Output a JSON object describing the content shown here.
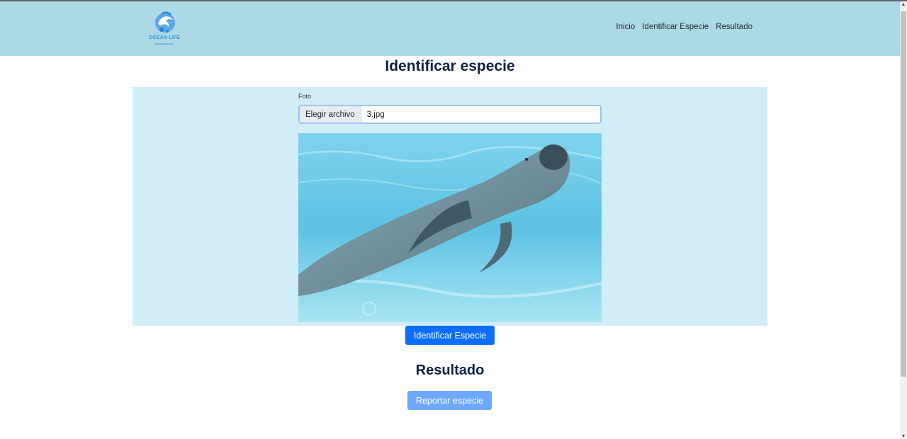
{
  "navbar": {
    "logo_text": "OCEAN LIFE",
    "links": [
      "Inicio",
      "Identificar Especie",
      "Resultado"
    ]
  },
  "main": {
    "title": "Identificar especie",
    "form": {
      "label": "Foto",
      "file_button_label": "Elegir archivo",
      "file_name": "3.jpg"
    },
    "identify_button": "Identificar Especie",
    "result_title": "Resultado",
    "report_button": "Reportar especie"
  },
  "icons": {
    "logo": "dolphin-logo-icon",
    "scroll_up": "arrow-up-icon",
    "scroll_down": "arrow-down-icon"
  },
  "colors": {
    "navbar_bg": "#add8e6",
    "card_bg": "#d1eef8",
    "heading": "#0d2149",
    "primary": "#0d6efd",
    "primary_light": "#6ea8fe"
  }
}
